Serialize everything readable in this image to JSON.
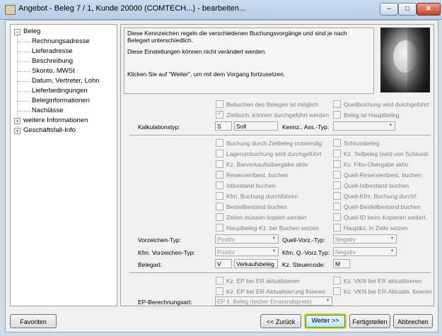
{
  "window": {
    "title": "Angebot - Beleg 7 / 1, Kunde 20000 (COMTECH...) - bearbeiten..."
  },
  "tree": {
    "root": "Beleg",
    "children": [
      "Rechnungsadresse",
      "Lieferadresse",
      "Beschreibung",
      "Skonto, MWSt",
      "Datum, Vertreter, Lohn",
      "Lieferbedingungen",
      "Beleginformationen",
      "Nachlässe"
    ],
    "expandable": [
      "weitere Informationen",
      "Geschäftsfall-Info"
    ]
  },
  "info": {
    "line1": "Diese Kennzeichen regeln die verschiedenen Buchungsvorgänge und sind je nach Belegart unterschiedlich.",
    "line2": "Diese Einstellungen können nicht verändert werden.",
    "line3": "Klicken Sie auf \"Weiter\", um mit dem Vorgang fortzusetzen."
  },
  "section1": {
    "cb_left": [
      {
        "label": "Bebuchen des Beleges ist möglich",
        "checked": false
      },
      {
        "label": "Zielbuch. können durchgeführt werden",
        "checked": true
      }
    ],
    "cb_right": [
      {
        "label": "Quellbuchung wird durchgeführt",
        "checked": false
      },
      {
        "label": "Beleg ist Hauptbeleg",
        "checked": false
      }
    ],
    "kalk_label": "Kalkulationstyp:",
    "kalk_code": "S",
    "kalk_value": "Soll",
    "kennz_label": "Kennz.. Ass.-Typ:",
    "kennz_value": ""
  },
  "section2": {
    "cb_left": [
      "Buchung durch Zielbeleg notwendig",
      "Lagerumbuchung wird durchgeführt",
      "Kz. Barverkaufsübergabe aktiv",
      "Reserviertbest. buchen",
      "Istbestand buchen",
      "Kfm. Buchung durchführen",
      "Bestellbestand buchen",
      "Zeilen müssen kopiert werden",
      "Hauptbeleg-Kz. bei Buchen setzen"
    ],
    "cb_right": [
      "Schlussbeleg",
      "Kz. Teilbeleg (wird von Schlusst",
      "Kz. Fibu-Übergabe aktiv",
      "Quell-Reserviertbest. buchen",
      "Quell-Istbestand buchen",
      "Quell-Kfm. Buchung durchf.",
      "Quell-Bestellbestand buchen",
      "Quell-ID beim Kopieren weiterl.",
      "Hauptkz. in Zeile setzen"
    ],
    "vz_label": "Vorzeichen-Typ:",
    "vz_value": "Positiv",
    "qvz_label": "Quell-Vorz.-Typ:",
    "qvz_value": "Negativ",
    "kvz_label": "Kfm. Vorzeichen-Typ:",
    "kvz_value": "Positiv",
    "kqvz_label": "Kfm. Q.-Vorz.Typ:",
    "kqvz_value": "Negativ",
    "belegart_label": "Belegart:",
    "belegart_code": "V",
    "belegart_value": "Verkaufsbeleg",
    "steuer_label": "Kz. Steuercode:",
    "steuer_value": "M"
  },
  "section3": {
    "cb_left": [
      "Kz. EP bei ER aktualisieren",
      "Kz. EP bei ER-Aktualisierung fixieren"
    ],
    "cb_right": [
      "Kz. VKN bei ER aktualisieren",
      "Kz. VKN bei ER-Aktualis. fixieren"
    ],
    "ep_label": "EP-Berechnungsart:",
    "ep_value": "EP lt. Beleg (letzter Einstandspreis)"
  },
  "buttons": {
    "favoriten": "Favoriten",
    "zurueck": "<< Zurück",
    "weiter": "Weiter >>",
    "fertigstellen": "Fertigstellen",
    "abbrechen": "Abbrechen"
  }
}
